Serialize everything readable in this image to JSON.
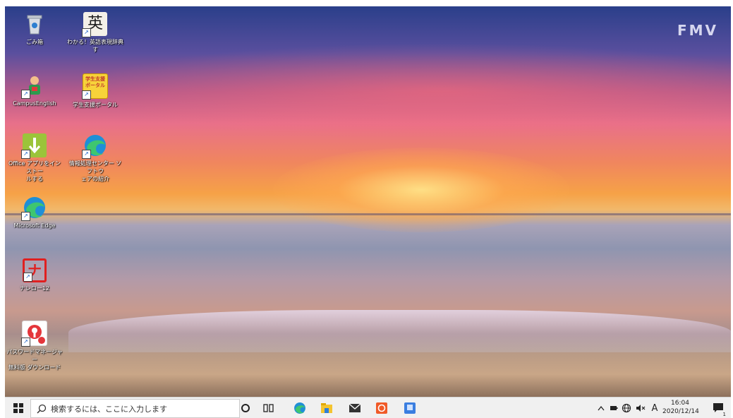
{
  "desktop": {
    "brand_logo": "FMV",
    "icons": [
      {
        "label": "ごみ箱",
        "icon": "recycle-bin-icon"
      },
      {
        "label": "わかる！英語表現辞典",
        "label_line2": "す",
        "icon": "english-dictionary-icon",
        "glyph": "英"
      },
      {
        "label": "CampusEnglish",
        "icon": "campus-english-icon"
      },
      {
        "label": "学生支援ポータル",
        "icon": "student-portal-icon",
        "glyph": "学生支援ポータル"
      },
      {
        "label": "Office アプリをインストー",
        "label_line2": "ルする",
        "icon": "office-install-icon"
      },
      {
        "label": "情報処理センター ソフトウ",
        "label_line2": "ェアの紹介",
        "icon": "edge-shortcut-icon"
      },
      {
        "label": "Microsoft Edge",
        "icon": "microsoft-edge-icon"
      },
      {
        "label": "ナレロー12",
        "icon": "narero-icon",
        "glyph": "ナ"
      },
      {
        "label": "パスワードマネージャー",
        "label_line2": "無料版 ダウンロード",
        "icon": "password-manager-icon"
      }
    ]
  },
  "taskbar": {
    "search_placeholder": "検索するには、ここに入力します",
    "ime_mode": "A",
    "time": "16:04",
    "date": "2020/12/14",
    "notification_count": "1"
  }
}
